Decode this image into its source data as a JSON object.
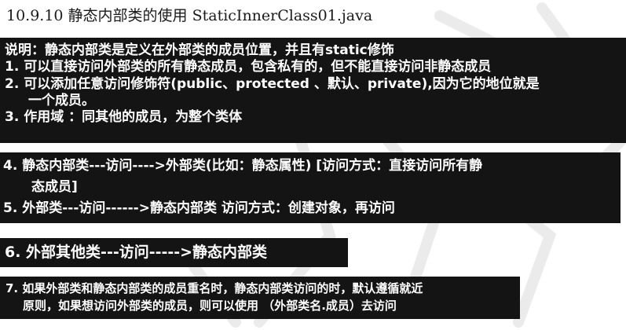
{
  "heading": "10.9.10 静态内部类的使用  StaticInnerClass01.java",
  "box1": {
    "lines": [
      "说明：静态内部类是定义在外部类的成员位置，并且有static修饰",
      "1. 可以直接访问外部类的所有静态成员，包含私有的，但不能直接访问非静态成员",
      "2. 可以添加任意访问修饰符(public、protected 、默认、private),因为它的地位就是",
      "一个成员。",
      "3. 作用域 ：同其他的成员，为整个类体"
    ]
  },
  "box2": {
    "lines": [
      "4.  静态内部类---访问---->外部类(比如：静态属性)  [访问方式：直接访问所有静",
      "态成员]",
      "5.  外部类---访问------>静态内部类 访问方式：创建对象，再访问"
    ]
  },
  "box3": {
    "text": "6.  外部其他类---访问----->静态内部类"
  },
  "box4": {
    "lines": [
      "7.  如果外部类和静态内部类的成员重名时，静态内部类访问的时，默认遵循就近",
      "原则，如果想访问外部类的成员，则可以使用 （外部类名.成员）去访问"
    ]
  }
}
